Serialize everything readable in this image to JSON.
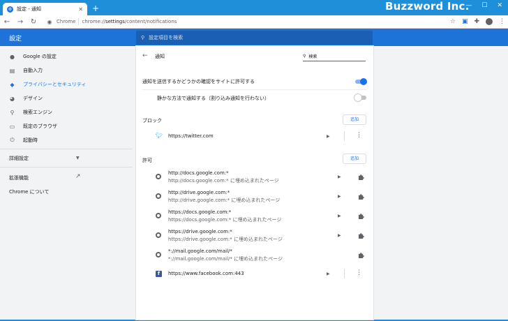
{
  "browser": {
    "tab_title": "設定 - 通知",
    "tab_favicon": "gear-icon",
    "brand": "Buzzword Inc.",
    "site_label": "Chrome",
    "url_host": "chrome://",
    "url_bold": "settings",
    "url_rest": "/content/notifications"
  },
  "header": {
    "title": "設定",
    "search_placeholder": "設定項目を検索"
  },
  "sidebar": {
    "items": [
      {
        "label": "Google の設定",
        "icon": "person-icon"
      },
      {
        "label": "自動入力",
        "icon": "clipboard-icon"
      },
      {
        "label": "プライバシーとセキュリティ",
        "icon": "shield-icon",
        "active": true
      },
      {
        "label": "デザイン",
        "icon": "palette-icon"
      },
      {
        "label": "検索エンジン",
        "icon": "search-icon"
      },
      {
        "label": "既定のブラウザ",
        "icon": "browser-icon"
      },
      {
        "label": "起動時",
        "icon": "power-icon"
      }
    ],
    "advanced": "詳細設定",
    "extensions": "拡張機能",
    "about": "Chrome について"
  },
  "page": {
    "title": "通知",
    "search_placeholder": "検索",
    "ask_label": "通知を送信するかどうかの確認をサイトに許可する",
    "ask_on": true,
    "quiet_label": "静かな方法で通知する（割り込み通知を行わない）",
    "quiet_on": false,
    "block_label": "ブロック",
    "allow_label": "許可",
    "add_label": "追加",
    "blocked": [
      {
        "site": "https://twitter.com",
        "icon": "twitter-icon"
      }
    ],
    "allowed": [
      {
        "site": "http://docs.google.com:*",
        "sub": "http://docs.google.com:* に埋め込まれたページ",
        "icon": "globe-icon",
        "action": "extension"
      },
      {
        "site": "http://drive.google.com:*",
        "sub": "http://drive.google.com:* に埋め込まれたページ",
        "icon": "globe-icon",
        "action": "extension"
      },
      {
        "site": "https://docs.google.com:*",
        "sub": "https://docs.google.com:* に埋め込まれたページ",
        "icon": "globe-icon",
        "action": "extension"
      },
      {
        "site": "https://drive.google.com:*",
        "sub": "https://drive.google.com:* に埋め込まれたページ",
        "icon": "globe-icon",
        "action": "extension"
      },
      {
        "site": "*://mail.google.com/mail/*",
        "sub": "*://mail.google.com/mail/* に埋め込まれたページ",
        "icon": "globe-icon",
        "action": "extension"
      },
      {
        "site": "https://www.facebook.com:443",
        "icon": "facebook-icon",
        "action": "menu"
      }
    ]
  },
  "colors": {
    "frame": "#1e8fd8",
    "header": "#1e73d8",
    "accent": "#1a73e8"
  }
}
